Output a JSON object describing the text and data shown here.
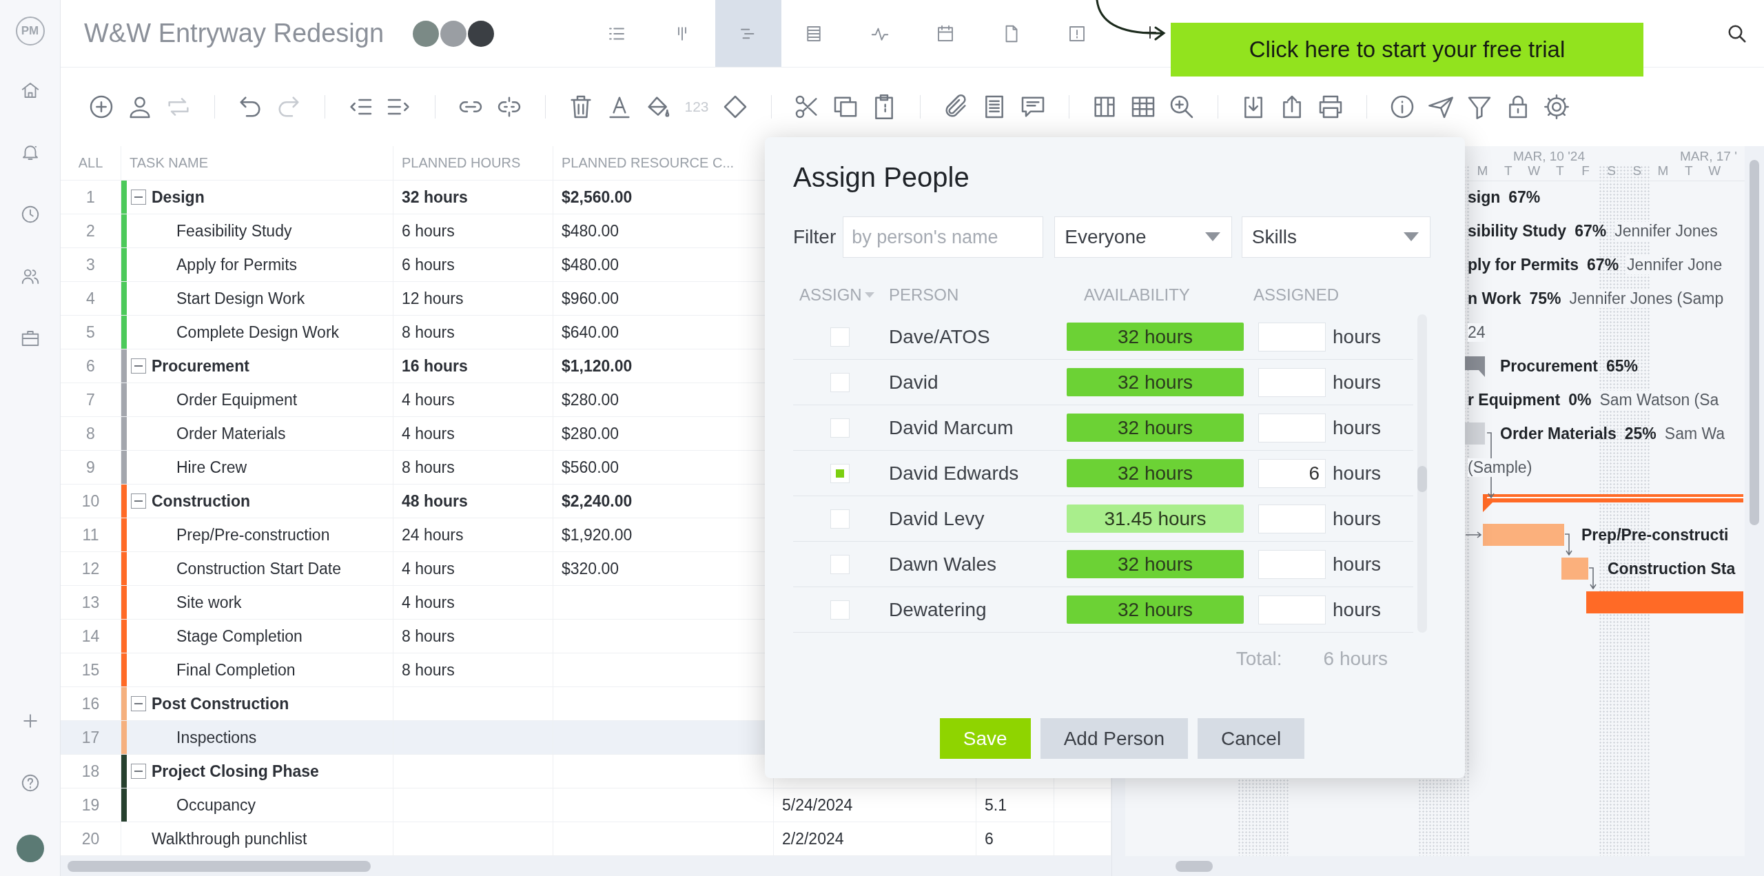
{
  "sidebar": {
    "logo": "PM",
    "items": [
      {
        "kind": "home"
      },
      {
        "kind": "notifications"
      },
      {
        "kind": "time"
      },
      {
        "kind": "team"
      },
      {
        "kind": "portfolio"
      }
    ],
    "bottom_items": [
      {
        "kind": "add"
      },
      {
        "kind": "help"
      }
    ]
  },
  "topbar": {
    "title": "W&W Entryway Redesign",
    "view_tabs": [
      {
        "kind": "list",
        "selected": false
      },
      {
        "kind": "board",
        "selected": false
      },
      {
        "kind": "gantt",
        "selected": true
      },
      {
        "kind": "sheet",
        "selected": false
      },
      {
        "kind": "dashboard",
        "selected": false
      },
      {
        "kind": "calendar",
        "selected": false
      },
      {
        "kind": "document",
        "selected": false
      },
      {
        "kind": "alert",
        "selected": false
      }
    ],
    "banner": "Click here to start your free trial"
  },
  "toolbar": [
    [
      {
        "kind": "add",
        "disabled": false
      },
      {
        "kind": "assign",
        "disabled": false
      },
      {
        "kind": "recurring",
        "disabled": true
      }
    ],
    [
      {
        "kind": "undo",
        "disabled": false
      },
      {
        "kind": "redo",
        "disabled": true
      }
    ],
    [
      {
        "kind": "outdent",
        "disabled": false
      },
      {
        "kind": "indent",
        "disabled": false
      }
    ],
    [
      {
        "kind": "link",
        "disabled": false
      },
      {
        "kind": "unlink",
        "disabled": false
      }
    ],
    [
      {
        "kind": "delete",
        "disabled": false
      },
      {
        "kind": "text_color",
        "disabled": false
      },
      {
        "kind": "fill_color",
        "disabled": false
      },
      {
        "kind": "number_format",
        "label": "123",
        "disabled": true
      },
      {
        "kind": "milestone",
        "disabled": false
      }
    ],
    [
      {
        "kind": "cut",
        "disabled": false
      },
      {
        "kind": "copy",
        "disabled": false
      },
      {
        "kind": "paste",
        "disabled": false
      }
    ],
    [
      {
        "kind": "attach",
        "disabled": false
      },
      {
        "kind": "notes",
        "disabled": false
      },
      {
        "kind": "comment",
        "disabled": false
      }
    ],
    [
      {
        "kind": "columns",
        "disabled": false
      },
      {
        "kind": "grid",
        "disabled": false
      },
      {
        "kind": "zoom",
        "disabled": false
      }
    ],
    [
      {
        "kind": "import",
        "disabled": false
      },
      {
        "kind": "export",
        "disabled": false
      },
      {
        "kind": "print",
        "disabled": false
      }
    ],
    [
      {
        "kind": "info",
        "disabled": false
      },
      {
        "kind": "send",
        "disabled": false
      },
      {
        "kind": "filter",
        "disabled": false
      },
      {
        "kind": "lock",
        "disabled": false
      },
      {
        "kind": "settings",
        "disabled": false
      }
    ]
  ],
  "table": {
    "columns": [
      "ALL",
      "TASK NAME",
      "PLANNED HOURS",
      "PLANNED RESOURCE C..."
    ]
  },
  "tasks": [
    {
      "num": "1",
      "name": "Design",
      "planned_hours": "32 hours",
      "planned_resource_cost": "$2,560.00",
      "color": "#4cc95a",
      "expanded": true,
      "selected": false,
      "children": [
        {
          "num": "2",
          "name": "Feasibility Study",
          "planned_hours": "6 hours",
          "planned_resource_cost": "$480.00",
          "selected": false
        },
        {
          "num": "3",
          "name": "Apply for Permits",
          "planned_hours": "6 hours",
          "planned_resource_cost": "$480.00",
          "selected": false
        },
        {
          "num": "4",
          "name": "Start Design Work",
          "planned_hours": "12 hours",
          "planned_resource_cost": "$960.00",
          "selected": false
        },
        {
          "num": "5",
          "name": "Complete Design Work",
          "planned_hours": "8 hours",
          "planned_resource_cost": "$640.00",
          "selected": false
        }
      ]
    },
    {
      "num": "6",
      "name": "Procurement",
      "planned_hours": "16 hours",
      "planned_resource_cost": "$1,120.00",
      "color": "#a3a6ad",
      "expanded": true,
      "selected": false,
      "children": [
        {
          "num": "7",
          "name": "Order Equipment",
          "planned_hours": "4 hours",
          "planned_resource_cost": "$280.00",
          "selected": false
        },
        {
          "num": "8",
          "name": "Order Materials",
          "planned_hours": "4 hours",
          "planned_resource_cost": "$280.00",
          "selected": false
        },
        {
          "num": "9",
          "name": "Hire Crew",
          "planned_hours": "8 hours",
          "planned_resource_cost": "$560.00",
          "selected": false
        }
      ]
    },
    {
      "num": "10",
      "name": "Construction",
      "planned_hours": "48 hours",
      "planned_resource_cost": "$2,240.00",
      "color": "#ff6a26",
      "expanded": true,
      "selected": false,
      "children": [
        {
          "num": "11",
          "name": "Prep/Pre-construction",
          "planned_hours": "24 hours",
          "planned_resource_cost": "$1,920.00",
          "selected": false
        },
        {
          "num": "12",
          "name": "Construction Start Date",
          "planned_hours": "4 hours",
          "planned_resource_cost": "$320.00",
          "selected": false
        },
        {
          "num": "13",
          "name": "Site work",
          "planned_hours": "4 hours",
          "selected": false
        },
        {
          "num": "14",
          "name": "Stage Completion",
          "planned_hours": "8 hours",
          "selected": false
        },
        {
          "num": "15",
          "name": "Final Completion",
          "planned_hours": "8 hours",
          "selected": false
        }
      ]
    },
    {
      "num": "16",
      "name": "Post Construction",
      "color": "#f5b07e",
      "expanded": true,
      "selected": false,
      "children": [
        {
          "num": "17",
          "name": "Inspections",
          "selected": true
        }
      ]
    },
    {
      "num": "18",
      "name": "Project Closing Phase",
      "color": "#26402e",
      "expanded": true,
      "selected": false,
      "children": [
        {
          "num": "19",
          "name": "Occupancy",
          "column_5": "5/24/2024",
          "column_6": "5.1",
          "selected": false
        }
      ]
    },
    {
      "num": "20",
      "name": "Walkthrough punchlist",
      "column_5": "2/2/2024",
      "column_6": "6",
      "selected": false
    }
  ],
  "gantt": {
    "months": [
      "MAR, 10 '24",
      "MAR, 17 '"
    ],
    "days": [
      "M",
      "T",
      "W",
      "T",
      "F",
      "S",
      "S",
      "M",
      "T",
      "W"
    ],
    "rows": [
      {
        "kind": "label",
        "name": "sign",
        "percent": "67%"
      },
      {
        "kind": "label",
        "name": "sibility Study",
        "percent": "67%",
        "assignee": "Jennifer Jones"
      },
      {
        "kind": "label",
        "name": "ply for Permits",
        "percent": "67%",
        "assignee": "Jennifer Jone"
      },
      {
        "kind": "label",
        "name": "n Work",
        "percent": "75%",
        "assignee": "Jennifer Jones (Samp"
      },
      {
        "kind": "label",
        "assignee": "24"
      },
      {
        "kind": "milestone",
        "color": "#8a8e96",
        "name": "Procurement",
        "percent": "65%"
      },
      {
        "kind": "label",
        "name": "r Equipment",
        "percent": "0%",
        "assignee": "Sam Watson (Sa"
      },
      {
        "kind": "bar",
        "color": "#d3d6db",
        "name": "Order Materials",
        "percent": "25%",
        "assignee": "Sam Wa"
      },
      {
        "kind": "label",
        "assignee": "(Sample)"
      },
      {
        "kind": "summary",
        "color": "#ff6a26"
      },
      {
        "kind": "bar",
        "color": "#fbb07c",
        "name": "Prep/Pre-constructi"
      },
      {
        "kind": "bar",
        "color": "#fbb07c",
        "name": "Construction Sta"
      },
      {
        "kind": "bar",
        "color": "#ff6a26"
      }
    ]
  },
  "dialog": {
    "title": "Assign People",
    "filter_label": "Filter",
    "search": {
      "placeholder": "by person's name"
    },
    "group_select": "Everyone",
    "skills_select": "Skills",
    "columns": [
      "ASSIGN",
      "PERSON",
      "AVAILABILITY",
      "ASSIGNED"
    ],
    "people": [
      {
        "name": "Dave/ATOS",
        "checked": false,
        "availability": "32 hours",
        "color": "#6cd235",
        "unit": "hours"
      },
      {
        "name": "David",
        "checked": false,
        "availability": "32 hours",
        "color": "#6cd235",
        "unit": "hours"
      },
      {
        "name": "David Marcum",
        "checked": false,
        "availability": "32 hours",
        "color": "#6cd235",
        "unit": "hours"
      },
      {
        "name": "David Edwards",
        "checked": true,
        "availability": "32 hours",
        "color": "#6cd235",
        "assigned": "6",
        "unit": "hours"
      },
      {
        "name": "David Levy",
        "checked": false,
        "availability": "31.45 hours",
        "color": "#a9ee8c",
        "unit": "hours"
      },
      {
        "name": "Dawn Wales",
        "checked": false,
        "availability": "32 hours",
        "color": "#6cd235",
        "unit": "hours"
      },
      {
        "name": "Dewatering",
        "checked": false,
        "availability": "32 hours",
        "color": "#6cd235",
        "unit": "hours"
      }
    ],
    "total_label": "Total:",
    "total": "6 hours",
    "buttons": [
      {
        "label": "Save",
        "kind": "primary"
      },
      {
        "label": "Add Person",
        "kind": "secondary"
      },
      {
        "label": "Cancel",
        "kind": "secondary"
      }
    ]
  }
}
